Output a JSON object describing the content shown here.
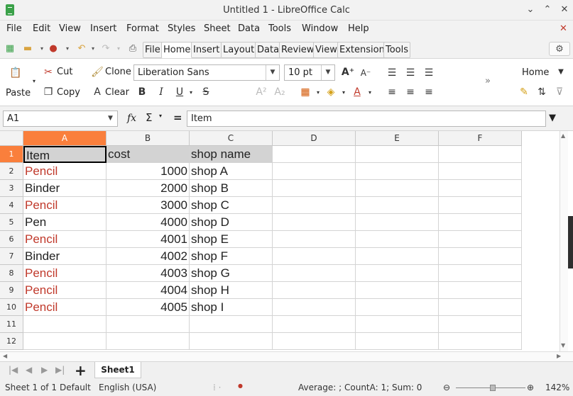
{
  "window": {
    "title": "Untitled 1 - LibreOffice Calc",
    "controls": {
      "minimize": "⌄",
      "maximize": "⌃",
      "close": "✕"
    }
  },
  "menubar": {
    "items": [
      "File",
      "Edit",
      "View",
      "Insert",
      "Format",
      "Styles",
      "Sheet",
      "Data",
      "Tools",
      "Window",
      "Help"
    ],
    "close_doc": "✕"
  },
  "tabs": [
    "File",
    "Home",
    "Insert",
    "Layout",
    "Data",
    "Review",
    "View",
    "Extension",
    "Tools"
  ],
  "active_tab": "Home",
  "ribbon": {
    "paste": "Paste",
    "cut": "Cut",
    "copy": "Copy",
    "clone": "Clone",
    "clear": "Clear",
    "font_name": "Liberation Sans",
    "font_size": "10 pt",
    "context_label": "Home",
    "overflow": "»"
  },
  "formula_bar": {
    "cell_ref": "A1",
    "fx": "fx",
    "sigma": "Σ",
    "equals": "=",
    "content": "Item"
  },
  "sheet": {
    "columns": [
      "A",
      "B",
      "C",
      "D",
      "E",
      "F"
    ],
    "selected_column": "A",
    "selected_row": "1",
    "row_numbers": [
      "1",
      "2",
      "3",
      "4",
      "5",
      "6",
      "7",
      "8",
      "9",
      "10",
      "11",
      "12"
    ],
    "header": [
      "Item",
      "cost",
      "shop name"
    ],
    "rows": [
      {
        "item": "Pencil",
        "cost": "1000",
        "shop": "shop A",
        "red": true
      },
      {
        "item": "Binder",
        "cost": "2000",
        "shop": "shop B",
        "red": false
      },
      {
        "item": "Pencil",
        "cost": "3000",
        "shop": "shop C",
        "red": true
      },
      {
        "item": "Pen",
        "cost": "4000",
        "shop": "shop D",
        "red": false
      },
      {
        "item": "Pencil",
        "cost": "4001",
        "shop": "shop E",
        "red": true
      },
      {
        "item": "Binder",
        "cost": "4002",
        "shop": "shop F",
        "red": false
      },
      {
        "item": "Pencil",
        "cost": "4003",
        "shop": "shop G",
        "red": true
      },
      {
        "item": "Pencil",
        "cost": "4004",
        "shop": "shop H",
        "red": true
      },
      {
        "item": "Pencil",
        "cost": "4005",
        "shop": "shop I",
        "red": true
      }
    ]
  },
  "sheet_tabs": {
    "add": "+",
    "active": "Sheet1"
  },
  "status": {
    "sheet": "Sheet 1 of 1",
    "style": "Default",
    "language": "English (USA)",
    "summary": "Average: ; CountA: 1; Sum: 0",
    "zoom": "142%"
  },
  "colors": {
    "accent": "#fa7f3c",
    "red_text": "#c0392b",
    "header_fill": "#d3d3d3"
  }
}
